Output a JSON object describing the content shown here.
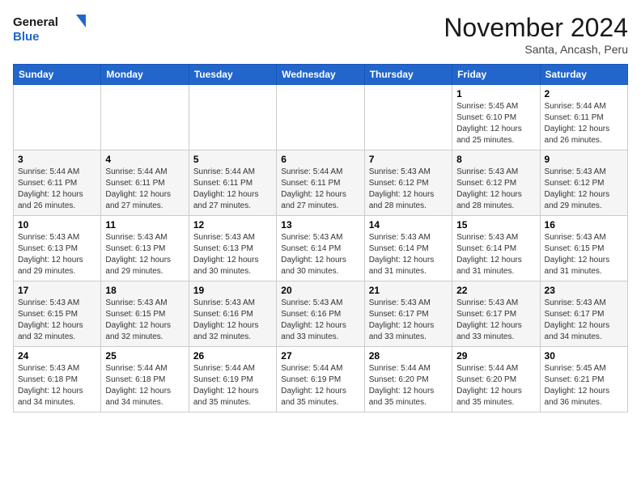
{
  "header": {
    "logo_line1": "General",
    "logo_line2": "Blue",
    "month": "November 2024",
    "location": "Santa, Ancash, Peru"
  },
  "days_of_week": [
    "Sunday",
    "Monday",
    "Tuesday",
    "Wednesday",
    "Thursday",
    "Friday",
    "Saturday"
  ],
  "weeks": [
    [
      {
        "day": "",
        "info": ""
      },
      {
        "day": "",
        "info": ""
      },
      {
        "day": "",
        "info": ""
      },
      {
        "day": "",
        "info": ""
      },
      {
        "day": "",
        "info": ""
      },
      {
        "day": "1",
        "info": "Sunrise: 5:45 AM\nSunset: 6:10 PM\nDaylight: 12 hours and 25 minutes."
      },
      {
        "day": "2",
        "info": "Sunrise: 5:44 AM\nSunset: 6:11 PM\nDaylight: 12 hours and 26 minutes."
      }
    ],
    [
      {
        "day": "3",
        "info": "Sunrise: 5:44 AM\nSunset: 6:11 PM\nDaylight: 12 hours and 26 minutes."
      },
      {
        "day": "4",
        "info": "Sunrise: 5:44 AM\nSunset: 6:11 PM\nDaylight: 12 hours and 27 minutes."
      },
      {
        "day": "5",
        "info": "Sunrise: 5:44 AM\nSunset: 6:11 PM\nDaylight: 12 hours and 27 minutes."
      },
      {
        "day": "6",
        "info": "Sunrise: 5:44 AM\nSunset: 6:11 PM\nDaylight: 12 hours and 27 minutes."
      },
      {
        "day": "7",
        "info": "Sunrise: 5:43 AM\nSunset: 6:12 PM\nDaylight: 12 hours and 28 minutes."
      },
      {
        "day": "8",
        "info": "Sunrise: 5:43 AM\nSunset: 6:12 PM\nDaylight: 12 hours and 28 minutes."
      },
      {
        "day": "9",
        "info": "Sunrise: 5:43 AM\nSunset: 6:12 PM\nDaylight: 12 hours and 29 minutes."
      }
    ],
    [
      {
        "day": "10",
        "info": "Sunrise: 5:43 AM\nSunset: 6:13 PM\nDaylight: 12 hours and 29 minutes."
      },
      {
        "day": "11",
        "info": "Sunrise: 5:43 AM\nSunset: 6:13 PM\nDaylight: 12 hours and 29 minutes."
      },
      {
        "day": "12",
        "info": "Sunrise: 5:43 AM\nSunset: 6:13 PM\nDaylight: 12 hours and 30 minutes."
      },
      {
        "day": "13",
        "info": "Sunrise: 5:43 AM\nSunset: 6:14 PM\nDaylight: 12 hours and 30 minutes."
      },
      {
        "day": "14",
        "info": "Sunrise: 5:43 AM\nSunset: 6:14 PM\nDaylight: 12 hours and 31 minutes."
      },
      {
        "day": "15",
        "info": "Sunrise: 5:43 AM\nSunset: 6:14 PM\nDaylight: 12 hours and 31 minutes."
      },
      {
        "day": "16",
        "info": "Sunrise: 5:43 AM\nSunset: 6:15 PM\nDaylight: 12 hours and 31 minutes."
      }
    ],
    [
      {
        "day": "17",
        "info": "Sunrise: 5:43 AM\nSunset: 6:15 PM\nDaylight: 12 hours and 32 minutes."
      },
      {
        "day": "18",
        "info": "Sunrise: 5:43 AM\nSunset: 6:15 PM\nDaylight: 12 hours and 32 minutes."
      },
      {
        "day": "19",
        "info": "Sunrise: 5:43 AM\nSunset: 6:16 PM\nDaylight: 12 hours and 32 minutes."
      },
      {
        "day": "20",
        "info": "Sunrise: 5:43 AM\nSunset: 6:16 PM\nDaylight: 12 hours and 33 minutes."
      },
      {
        "day": "21",
        "info": "Sunrise: 5:43 AM\nSunset: 6:17 PM\nDaylight: 12 hours and 33 minutes."
      },
      {
        "day": "22",
        "info": "Sunrise: 5:43 AM\nSunset: 6:17 PM\nDaylight: 12 hours and 33 minutes."
      },
      {
        "day": "23",
        "info": "Sunrise: 5:43 AM\nSunset: 6:17 PM\nDaylight: 12 hours and 34 minutes."
      }
    ],
    [
      {
        "day": "24",
        "info": "Sunrise: 5:43 AM\nSunset: 6:18 PM\nDaylight: 12 hours and 34 minutes."
      },
      {
        "day": "25",
        "info": "Sunrise: 5:44 AM\nSunset: 6:18 PM\nDaylight: 12 hours and 34 minutes."
      },
      {
        "day": "26",
        "info": "Sunrise: 5:44 AM\nSunset: 6:19 PM\nDaylight: 12 hours and 35 minutes."
      },
      {
        "day": "27",
        "info": "Sunrise: 5:44 AM\nSunset: 6:19 PM\nDaylight: 12 hours and 35 minutes."
      },
      {
        "day": "28",
        "info": "Sunrise: 5:44 AM\nSunset: 6:20 PM\nDaylight: 12 hours and 35 minutes."
      },
      {
        "day": "29",
        "info": "Sunrise: 5:44 AM\nSunset: 6:20 PM\nDaylight: 12 hours and 35 minutes."
      },
      {
        "day": "30",
        "info": "Sunrise: 5:45 AM\nSunset: 6:21 PM\nDaylight: 12 hours and 36 minutes."
      }
    ]
  ]
}
